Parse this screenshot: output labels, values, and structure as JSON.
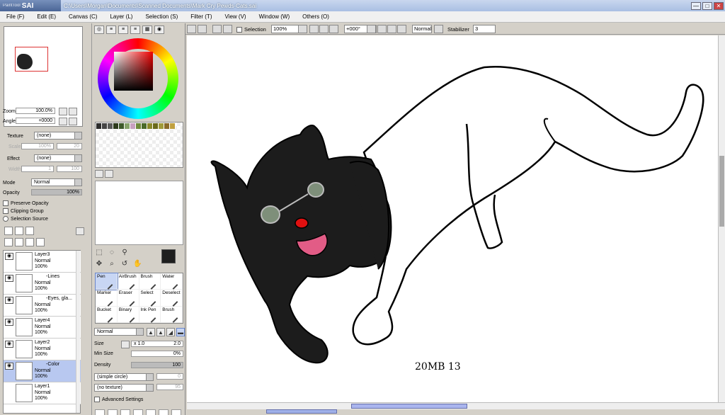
{
  "window": {
    "logo_small": "PaintTool",
    "logo": "SAI",
    "title": "C:\\Users\\Morgan\\Documents\\Scanned Documents\\Mark Cry Pewds-Cats.sai",
    "btn_min": "—",
    "btn_max": "□",
    "btn_close": "✕"
  },
  "menu": [
    "File (F)",
    "Edit (E)",
    "Canvas (C)",
    "Layer (L)",
    "Selection (S)",
    "Filter (T)",
    "View (V)",
    "Window (W)",
    "Others (O)"
  ],
  "navigator": {
    "zoom_label": "Zoom",
    "zoom_value": "100.0%",
    "angle_label": "Angle",
    "angle_value": "+0000"
  },
  "layer_props": {
    "texture_label": "Texture",
    "texture_value": "(none)",
    "scale_label": "Scale",
    "scale_value": "100%",
    "scale_num": "20",
    "effect_label": "Effect",
    "effect_value": "(none)",
    "width_label": "Width",
    "width_value": "1",
    "width_num": "100",
    "mode_label": "Mode",
    "mode_value": "Normal",
    "opacity_label": "Opacity",
    "opacity_value": "100%",
    "preserve_opacity": "Preserve Opacity",
    "clipping_group": "Clipping Group",
    "selection_source": "Selection Source"
  },
  "layers": [
    {
      "name": "Layer3",
      "mode": "Normal",
      "opacity": "100%",
      "selected": false
    },
    {
      "name": "-Lines",
      "mode": "Normal",
      "opacity": "100%",
      "selected": false
    },
    {
      "name": "-Eyes, gla...",
      "mode": "Normal",
      "opacity": "100%",
      "selected": false
    },
    {
      "name": "Layer4",
      "mode": "Normal",
      "opacity": "100%",
      "selected": false
    },
    {
      "name": "Layer2",
      "mode": "Normal",
      "opacity": "100%",
      "selected": false
    },
    {
      "name": "-Color",
      "mode": "Normal",
      "opacity": "100%",
      "selected": true
    },
    {
      "name": "Layer1",
      "mode": "Normal",
      "opacity": "100%",
      "selected": false
    }
  ],
  "brushes": [
    {
      "name": "Pen",
      "selected": true
    },
    {
      "name": "AirBrush",
      "selected": false
    },
    {
      "name": "Brush",
      "selected": false
    },
    {
      "name": "Water",
      "selected": false
    },
    {
      "name": "Marker",
      "selected": false
    },
    {
      "name": "Eraser",
      "selected": false
    },
    {
      "name": "Select",
      "selected": false
    },
    {
      "name": "Deselect",
      "selected": false
    },
    {
      "name": "Bucket",
      "selected": false
    },
    {
      "name": "Binary",
      "selected": false
    },
    {
      "name": "Ink Pen",
      "selected": false
    },
    {
      "name": "Brush",
      "selected": false
    }
  ],
  "brush_params": {
    "blend_mode": "Normal",
    "size_label": "Size",
    "size_mult": "x 1.0",
    "size_value": "2.0",
    "min_size_label": "Min Size",
    "min_size_value": "0%",
    "density_label": "Density",
    "density_value": "100",
    "shape_value": "(simple circle)",
    "shape_num": "0",
    "texture_value": "(no texture)",
    "texture_num": "95",
    "advanced_settings": "Advanced Settings"
  },
  "toolbar": {
    "selection_label": "Selection",
    "zoom_value": "100%",
    "angle_value": "+000°",
    "mode_value": "Normal",
    "stabilizer_label": "Stabilizer",
    "stabilizer_value": "3"
  },
  "swatch_colors": [
    "#2c2c2c",
    "#454545",
    "#5a5a5a",
    "#2d3a1c",
    "#3d5a2a",
    "#86a36b",
    "#c8a0c0",
    "#6e8a3a",
    "#4a6a2a",
    "#8a8a2a",
    "#6a6a1a",
    "#a09a3a",
    "#8a6a2a",
    "#c0a040"
  ],
  "signature_text": "20MB 13",
  "colors": {
    "accent": "#6a86c9",
    "selected_layer": "#b8c8f0",
    "panel": "#d4d0c8"
  }
}
